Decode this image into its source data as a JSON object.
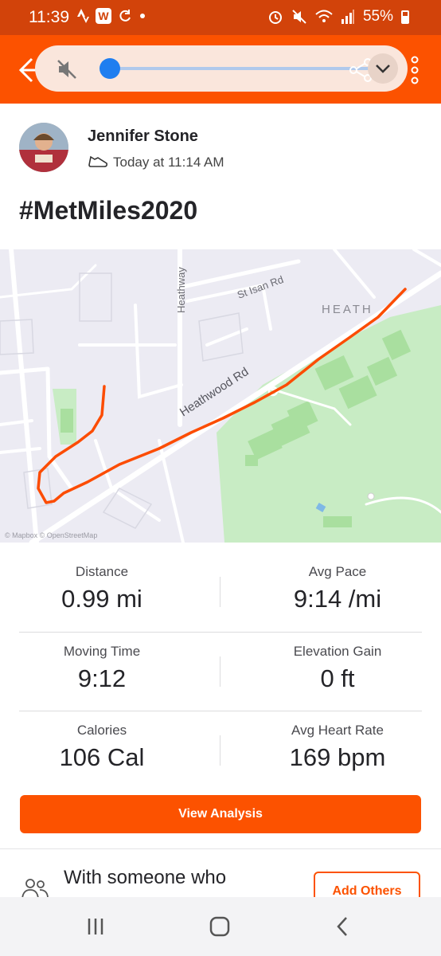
{
  "status_bar": {
    "time": "11:39",
    "battery": "55%",
    "badge": "W"
  },
  "header": {
    "media_slider_level": 0.03,
    "accent_color": "#fc5200"
  },
  "activity": {
    "athlete_name": "Jennifer Stone",
    "timestamp": "Today at 11:14 AM",
    "title": "#MetMiles2020",
    "sport_icon": "shoe-icon"
  },
  "map": {
    "labels": {
      "st_isan_rd": "St Isan Rd",
      "heathway": "Heathway",
      "heath": "HEATH",
      "heathwood_rd": "Heathwood Rd"
    },
    "attribution": "© Mapbox © OpenStreetMap",
    "route_color": "#fc4c02"
  },
  "stats": [
    {
      "left_label": "Distance",
      "left_value": "0.99 mi",
      "right_label": "Avg Pace",
      "right_value": "9:14 /mi"
    },
    {
      "left_label": "Moving Time",
      "left_value": "9:12",
      "right_label": "Elevation Gain",
      "right_value": "0 ft"
    },
    {
      "left_label": "Calories",
      "left_value": "106 Cal",
      "right_label": "Avg Heart Rate",
      "right_value": "169 bpm"
    }
  ],
  "actions": {
    "view_analysis": "View Analysis",
    "with_someone": "With someone who",
    "add_others": "Add Others"
  }
}
